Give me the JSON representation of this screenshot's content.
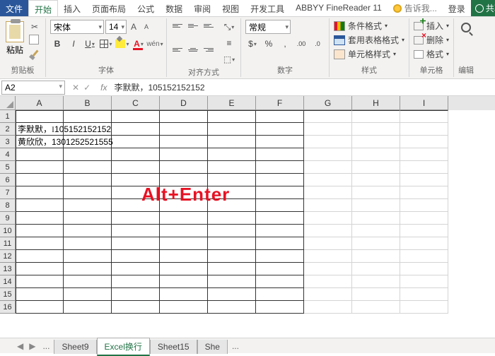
{
  "tabs": {
    "file": "文件",
    "home": "开始",
    "insert": "插入",
    "layout": "页面布局",
    "formula": "公式",
    "data": "数据",
    "review": "审阅",
    "view": "视图",
    "dev": "开发工具",
    "abbyy": "ABBYY FineReader 11",
    "tellme": "告诉我...",
    "login": "登录",
    "share": "共享"
  },
  "ribbon": {
    "clipboard": {
      "paste": "粘贴",
      "label": "剪贴板"
    },
    "font": {
      "name": "宋体",
      "size": "14",
      "label": "字体"
    },
    "align": {
      "label": "对齐方式"
    },
    "number": {
      "format": "常规",
      "label": "数字"
    },
    "styles": {
      "cond": "条件格式",
      "table": "套用表格格式",
      "cell": "单元格样式",
      "label": "样式"
    },
    "cells": {
      "insert": "插入",
      "delete": "删除",
      "format": "格式",
      "label": "单元格"
    },
    "editing": {
      "label": "编辑"
    }
  },
  "fxbar": {
    "ref": "A2",
    "value": "李默默，105152152152"
  },
  "cols": [
    "A",
    "B",
    "C",
    "D",
    "E",
    "F",
    "G",
    "H",
    "I"
  ],
  "rows": [
    "1",
    "2",
    "3",
    "4",
    "5",
    "6",
    "7",
    "8",
    "9",
    "10",
    "11",
    "12",
    "13",
    "14",
    "15",
    "16"
  ],
  "celldata": {
    "A2": "李默默，",
    "A2overflow": "105152152152",
    "A3": "黄欣欣，1301252521555"
  },
  "overlay": "Alt+Enter",
  "sheets": {
    "nav": "...",
    "s1": "Sheet9",
    "s2": "Excel换行",
    "s3": "Sheet15",
    "s4": "She"
  }
}
